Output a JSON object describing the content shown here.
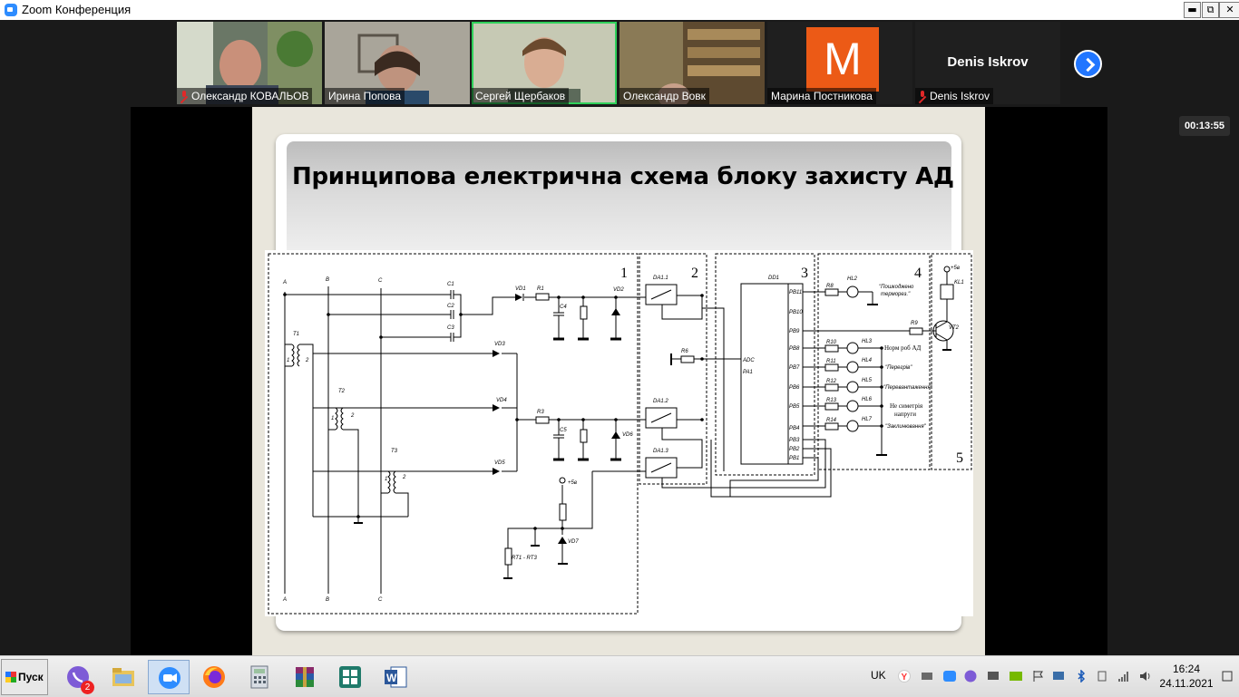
{
  "window": {
    "title": "Zoom Конференция",
    "min": "▬",
    "max": "⧉",
    "close": "✕"
  },
  "participants": [
    {
      "name": "Олександр КОВАЛЬОВ",
      "muted": true
    },
    {
      "name": "Ирина Попова",
      "muted": false
    },
    {
      "name": "Сергей Щербаков",
      "muted": false,
      "active": true
    },
    {
      "name": "Олександр Вовк",
      "muted": false
    },
    {
      "name": "Марина Постникова",
      "muted": false,
      "avatar_letter": "M",
      "avatar_color": "#ec5a16"
    },
    {
      "name": "Denis Iskrov",
      "muted": true,
      "title": "Denis Iskrov"
    }
  ],
  "timer": "00:13:55",
  "slide": {
    "title": "Принципова електрична схема блоку захисту АД",
    "blocks": [
      "1",
      "2",
      "3",
      "4",
      "5"
    ],
    "labels": {
      "A": "A",
      "B": "B",
      "C": "C",
      "C1": "C1",
      "C2": "C2",
      "C3": "C3",
      "T1": "T1",
      "T2": "T2",
      "T3": "T3",
      "w1": "1",
      "w2": "2",
      "VD1": "VD1",
      "VD2": "VD2",
      "VD3": "VD3",
      "VD4": "VD4",
      "VD5": "VD5",
      "VD6": "VD6",
      "VD7": "VD7",
      "R1": "R1",
      "R2": "R2",
      "R3": "R3",
      "R4": "R4",
      "R5": "R5",
      "R6": "R6",
      "C4": "C4",
      "C5": "C5",
      "plus5": "+5в",
      "rt": "RT1 - RT3",
      "DA1_1": "DA1.1",
      "DA1_2": "DA1.2",
      "DA1_3": "DA1.3",
      "DD1": "DD1",
      "ADC": "ADC",
      "PA1": "PA1",
      "PB11": "PB11",
      "PB10": "PB10",
      "PB9": "PB9",
      "PB8": "PB8",
      "PB7": "PB7",
      "PB6": "PB6",
      "PB5": "PB5",
      "PB4": "PB4",
      "PB3": "PB3",
      "PB2": "PB2",
      "PB1": "PB1",
      "R8": "R8",
      "R9": "R9",
      "R10": "R10",
      "R11": "R11",
      "R12": "R12",
      "R13": "R13",
      "R14": "R14",
      "HL2": "HL2",
      "HL3": "HL3",
      "HL4": "HL4",
      "HL5": "HL5",
      "HL6": "HL6",
      "HL7": "HL7",
      "pl5b": "+5в",
      "KL1": "KL1",
      "VT2": "VT2",
      "t_dam1": "\"Пошкоджено",
      "t_dam2": "терморез.\"",
      "t_norm": "Норм роб АД",
      "t_heat": "\"Перегрів\"",
      "t_over": "\"Перевантаження\"",
      "t_asym1": "Не симетрія",
      "t_asym2": "напруги",
      "t_block": "\"Заклинювання\""
    }
  },
  "taskbar": {
    "start": "Пуск",
    "viber_badge": "2",
    "lang": "UK",
    "time": "16:24",
    "date": "24.11.2021"
  },
  "colors": {
    "zoom_blue": "#2d8cff",
    "active_green": "#2fd05a",
    "muted_red": "#e02828"
  }
}
